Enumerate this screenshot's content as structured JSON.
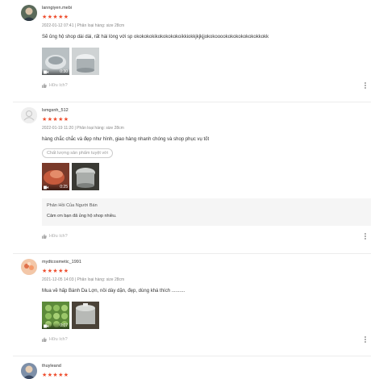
{
  "reviews": [
    {
      "username": "lanngiyen.mebi",
      "rating": 5,
      "meta": "2022-01-12 07:41 | Phân loại hàng: size 28cm",
      "comment": "Sẽ ủng hộ shop dài dài, rất hài lòng với sp okokokokikokokokokoikkiokkjkjkjjokokooookokokokokokokkokk",
      "tag": null,
      "media": [
        {
          "type": "video",
          "duration": "0:30",
          "icon": "video-camera-icon"
        },
        {
          "type": "image",
          "icon": "product-photo"
        }
      ],
      "seller_reply": null,
      "like_label": "Hữu ích?"
    },
    {
      "username": "lsmgsnh_512",
      "rating": 5,
      "meta": "2022-01-19 11:20 | Phân loại hàng: size 28cm",
      "comment": "hàng chắc chắc và đẹp như hình, giao hàng nhanh chóng và shop phục vụ tốt",
      "tag": "Chất lượng sản phẩm tuyệt vời",
      "media": [
        {
          "type": "video",
          "duration": "0:25",
          "icon": "video-camera-icon"
        },
        {
          "type": "image",
          "icon": "product-photo"
        }
      ],
      "seller_reply": {
        "title": "Phản Hồi Của Người Bán",
        "text": "Cảm ơn bạn đã ủng hộ shop nhiều."
      },
      "like_label": "Hữu ích?"
    },
    {
      "username": "mydtcosmetic_1991",
      "rating": 5,
      "meta": "2021-12-05 14:03 | Phân loại hàng: size 28cm",
      "comment": "Mua về hấp Bánh Da Lợn, nồi dày dặn, đẹp, dùng khá thích ..........",
      "tag": null,
      "media": [
        {
          "type": "video",
          "duration": "0:07",
          "icon": "video-camera-icon"
        },
        {
          "type": "image",
          "icon": "product-photo"
        }
      ],
      "seller_reply": null,
      "like_label": "Hữu ích?"
    },
    {
      "username": "thuyleand",
      "rating": 5
    }
  ],
  "colors": {
    "star": "#ee4d2d",
    "meta_text": "#888888",
    "reply_bg": "#f5f5f5",
    "divider": "#ececec"
  }
}
